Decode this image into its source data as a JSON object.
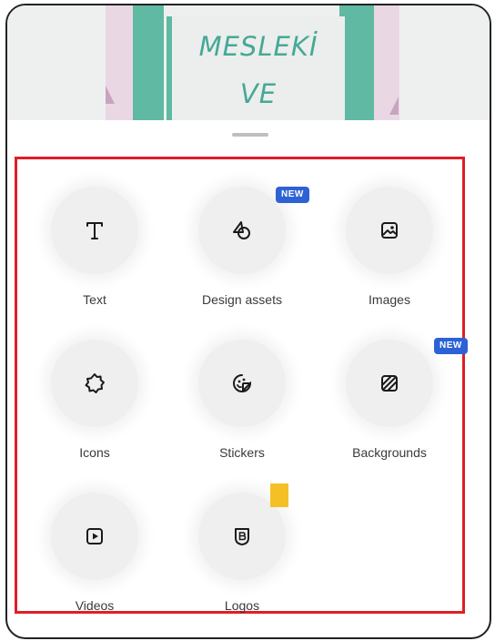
{
  "preview": {
    "line1": "MESLEKİ",
    "line2": "VE"
  },
  "tools": [
    {
      "label": "Text",
      "icon": "text-icon",
      "badge": ""
    },
    {
      "label": "Design assets",
      "icon": "design-assets-icon",
      "badge": "NEW"
    },
    {
      "label": "Images",
      "icon": "image-icon",
      "badge": ""
    },
    {
      "label": "Icons",
      "icon": "icons-icon",
      "badge": ""
    },
    {
      "label": "Stickers",
      "icon": "sticker-icon",
      "badge": ""
    },
    {
      "label": "Backgrounds",
      "icon": "background-icon",
      "badge": "NEW"
    },
    {
      "label": "Videos",
      "icon": "video-icon",
      "badge": ""
    },
    {
      "label": "Logos",
      "icon": "logo-icon",
      "badge": "premium"
    }
  ],
  "colors": {
    "badge": "#2d62d6",
    "highlight": "#e01e26",
    "premium": "#f5c026",
    "preview_accent": "#5fb9a3"
  }
}
